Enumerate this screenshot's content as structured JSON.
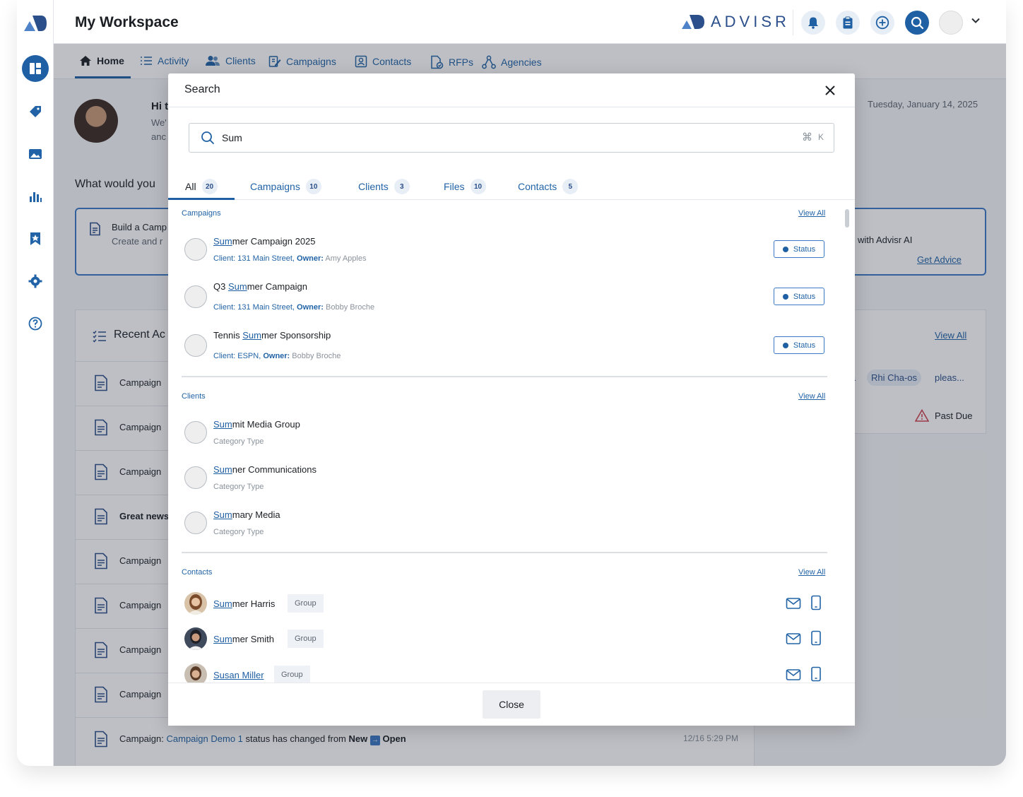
{
  "app": {
    "workspace_title": "My Workspace",
    "brand_name": "ADVISR",
    "accent_color": "#1f5fa3"
  },
  "nav": {
    "items": [
      {
        "label": "Home",
        "icon": "home-icon"
      },
      {
        "label": "Activity",
        "icon": "list-icon"
      },
      {
        "label": "Clients",
        "icon": "users-icon"
      },
      {
        "label": "Campaigns",
        "icon": "edit-icon"
      },
      {
        "label": "Contacts",
        "icon": "contact-card-icon"
      },
      {
        "label": "RFPs",
        "icon": "document-check-icon"
      },
      {
        "label": "Agencies",
        "icon": "network-icon"
      }
    ]
  },
  "background": {
    "greeting": "Hi t",
    "greeting_line2": "We'",
    "greeting_line3": "anc",
    "date": "Tuesday, January 14, 2025",
    "prompt": "What would you",
    "card_left_title": "Build a Camp",
    "card_left_sub": "Create and r",
    "card_right_title": "with Advisr AI",
    "card_right_link": "Get Advice",
    "recent_title": "Recent Ac",
    "recent_rows": [
      "Campaign",
      "Campaign",
      "Campaign",
      "Great news",
      "Campaign",
      "Campaign",
      "Campaign",
      "Campaign"
    ],
    "last_row": {
      "prefix": "Campaign:",
      "link": "Campaign Demo 1",
      "middle": "status has changed from",
      "from": "New",
      "to": "Open",
      "time": "12/16 5:29 PM"
    },
    "right_panel": {
      "view_all": "View All",
      "tag_partial": "ia",
      "tag_name": "Rhi Cha-os",
      "tag_after": "pleas...",
      "past_due": "Past Due"
    }
  },
  "search_modal": {
    "title": "Search",
    "query": "Sum",
    "placeholder": "Search",
    "shortcut_key": "K",
    "tabs": [
      {
        "label": "All",
        "count": "20"
      },
      {
        "label": "Campaigns",
        "count": "10"
      },
      {
        "label": "Clients",
        "count": "3"
      },
      {
        "label": "Files",
        "count": "10"
      },
      {
        "label": "Contacts",
        "count": "5"
      }
    ],
    "campaigns": {
      "label": "Campaigns",
      "view_all": "View All",
      "items": [
        {
          "match": "Sum",
          "rest": "mer Campaign 2025",
          "pre": "",
          "client": "131 Main Street,",
          "owner": "Amy Apples",
          "status": "Status"
        },
        {
          "match": "Sum",
          "rest": "mer Campaign",
          "pre": "Q3 ",
          "client": "131 Main Street,",
          "owner": "Bobby Broche",
          "status": "Status"
        },
        {
          "match": "Sum",
          "rest": "mer Sponsorship",
          "pre": "Tennis ",
          "client": "ESPN,",
          "owner": "Bobby Broche",
          "status": "Status"
        }
      ],
      "client_label": "Client:",
      "owner_label": "Owner:"
    },
    "clients": {
      "label": "Clients",
      "view_all": "View All",
      "items": [
        {
          "match": "Sum",
          "rest": "mit Media Group",
          "sub": "Category Type"
        },
        {
          "match": "Sum",
          "rest": "ner Communications",
          "sub": "Category Type"
        },
        {
          "match": "Sum",
          "rest": "mary Media",
          "sub": "Category Type"
        }
      ]
    },
    "contacts": {
      "label": "Contacts",
      "view_all": "View All",
      "items": [
        {
          "match": "Sum",
          "rest": "mer Harris",
          "chip": "Group"
        },
        {
          "match": "Sum",
          "rest": "mer Smith",
          "chip": "Group"
        },
        {
          "match": "Susan Miller",
          "rest": "",
          "chip": "Group"
        }
      ]
    },
    "close_label": "Close"
  }
}
